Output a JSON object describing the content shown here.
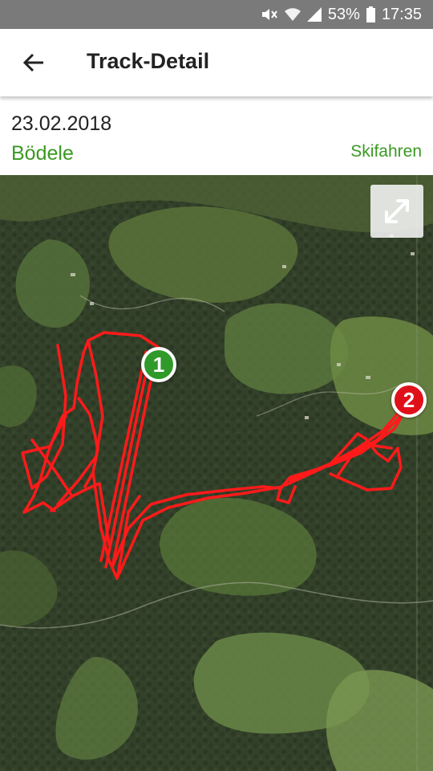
{
  "status_bar": {
    "battery": "53%",
    "time": "17:35",
    "icons": [
      "mute-icon",
      "wifi-icon",
      "signal-icon",
      "battery-icon"
    ]
  },
  "app_bar": {
    "title": "Track-Detail",
    "back_icon": "back-arrow-icon"
  },
  "track": {
    "date": "23.02.2018",
    "location": "Bödele",
    "activity": "Skifahren"
  },
  "map": {
    "type": "satellite",
    "track_color": "#ff1a1a",
    "start_marker": "1",
    "end_marker": "2",
    "expand_icon": "expand-icon"
  },
  "colors": {
    "accent": "#3a9a22",
    "start": "#2f9a2a",
    "end": "#e0101a"
  }
}
